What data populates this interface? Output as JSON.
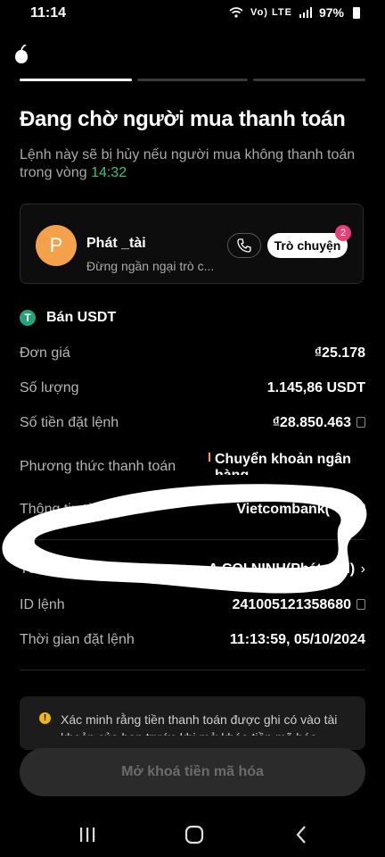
{
  "status_bar": {
    "time": "11:14",
    "battery": "97%",
    "network": "Vo) LTE"
  },
  "page": {
    "title": "Đang chờ người mua thanh toán",
    "subtitle": "Lệnh này sẽ bị hủy nếu người mua không thanh toán trong vòng",
    "timer": "14:32"
  },
  "buyer": {
    "avatar_letter": "P",
    "name": "Phát _tài",
    "message_preview": "Đừng ngần ngại trò c...",
    "chat_label": "Trò chuyện",
    "unread_count": "2"
  },
  "order": {
    "section_title": "Bán USDT",
    "rows": [
      {
        "label": "Đơn giá",
        "value": "₫25.178"
      },
      {
        "label": "Số lượng",
        "value": "1.145,86 USDT"
      },
      {
        "label": "Số tiền đặt lệnh",
        "value": "₫28.850.463"
      },
      {
        "label": "Phương thức thanh toán",
        "value": "Chuyển khoản ngân hàng"
      },
      {
        "label": "Thông tin tài khoản",
        "value": "Vietcombank(*53"
      },
      {
        "label": "Tên người mua",
        "value": "A COI NINH(Phát _tài)"
      },
      {
        "label": "ID lệnh",
        "value": "241005121358680"
      },
      {
        "label": "Thời gian đặt lệnh",
        "value": "11:13:59, 05/10/2024"
      }
    ]
  },
  "notice": {
    "text": "Xác minh rằng tiền thanh toán được ghi có vào tài khoản của bạn trước khi mở khóa tiền mã hóa. Bạn"
  },
  "footer": {
    "unlock_label": "Mở khoá tiền mã hóa"
  },
  "colors": {
    "accent_green": "#3bc279",
    "badge": "#e3417a",
    "avatar": "#f5a04a",
    "tether": "#26a17b"
  }
}
